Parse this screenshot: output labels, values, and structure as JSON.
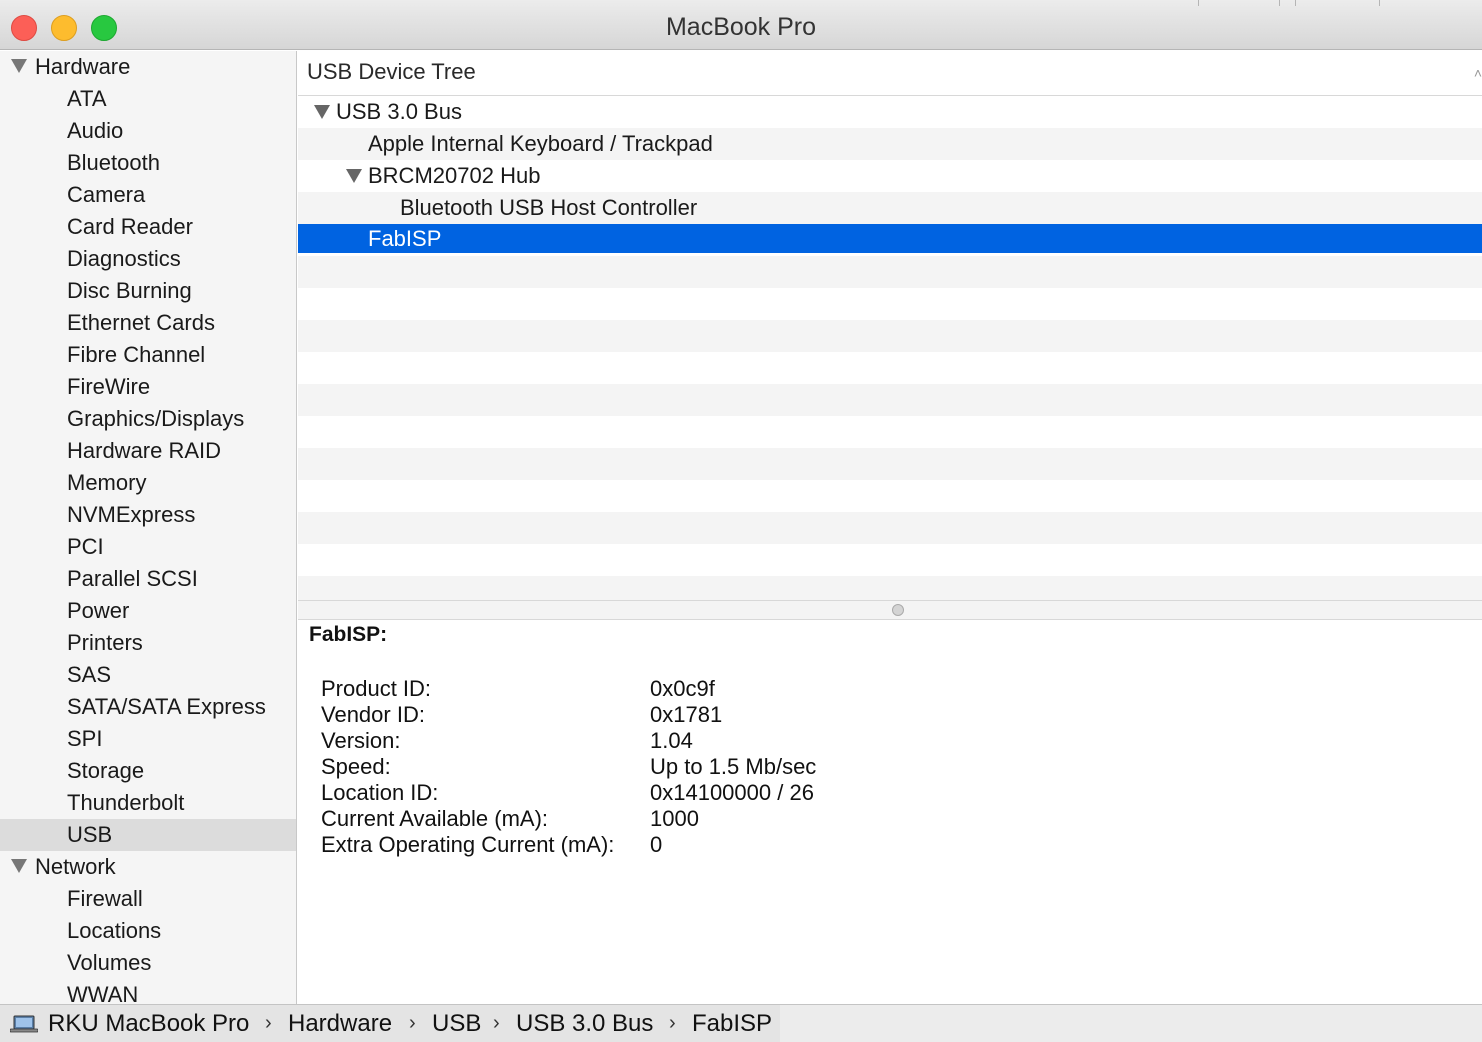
{
  "window": {
    "title": "MacBook Pro"
  },
  "sidebar": {
    "groups": [
      {
        "label": "Hardware",
        "items": [
          "ATA",
          "Audio",
          "Bluetooth",
          "Camera",
          "Card Reader",
          "Diagnostics",
          "Disc Burning",
          "Ethernet Cards",
          "Fibre Channel",
          "FireWire",
          "Graphics/Displays",
          "Hardware RAID",
          "Memory",
          "NVMExpress",
          "PCI",
          "Parallel SCSI",
          "Power",
          "Printers",
          "SAS",
          "SATA/SATA Express",
          "SPI",
          "Storage",
          "Thunderbolt",
          "USB"
        ]
      },
      {
        "label": "Network",
        "items": [
          "Firewall",
          "Locations",
          "Volumes",
          "WWAN"
        ]
      }
    ],
    "selected": "USB"
  },
  "tree": {
    "header": "USB Device Tree",
    "rows": [
      {
        "label": "USB 3.0 Bus",
        "depth": 0,
        "expanded": true
      },
      {
        "label": "Apple Internal Keyboard / Trackpad",
        "depth": 1,
        "expanded": null
      },
      {
        "label": "BRCM20702 Hub",
        "depth": 1,
        "expanded": true
      },
      {
        "label": "Bluetooth USB Host Controller",
        "depth": 2,
        "expanded": null
      },
      {
        "label": "FabISP",
        "depth": 1,
        "expanded": null,
        "selected": true
      }
    ]
  },
  "detail": {
    "title": "FabISP:",
    "properties": [
      {
        "key": "Product ID:",
        "value": "0x0c9f"
      },
      {
        "key": "Vendor ID:",
        "value": "0x1781"
      },
      {
        "key": "Version:",
        "value": "1.04"
      },
      {
        "key": "Speed:",
        "value": "Up to 1.5 Mb/sec"
      },
      {
        "key": "Location ID:",
        "value": "0x14100000 / 26"
      },
      {
        "key": "Current Available (mA):",
        "value": "1000"
      },
      {
        "key": "Extra Operating Current (mA):",
        "value": "0"
      }
    ]
  },
  "pathbar": {
    "icon": "laptop-icon",
    "segments": [
      "RKU MacBook Pro",
      "Hardware",
      "USB",
      "USB 3.0 Bus",
      "FabISP"
    ],
    "separator": "›"
  },
  "colors": {
    "selection": "#0063e1",
    "sidebar_selected": "#dcdcdc",
    "close": "#fc5f57",
    "minimize": "#fdbc2e",
    "maximize": "#28c840"
  }
}
